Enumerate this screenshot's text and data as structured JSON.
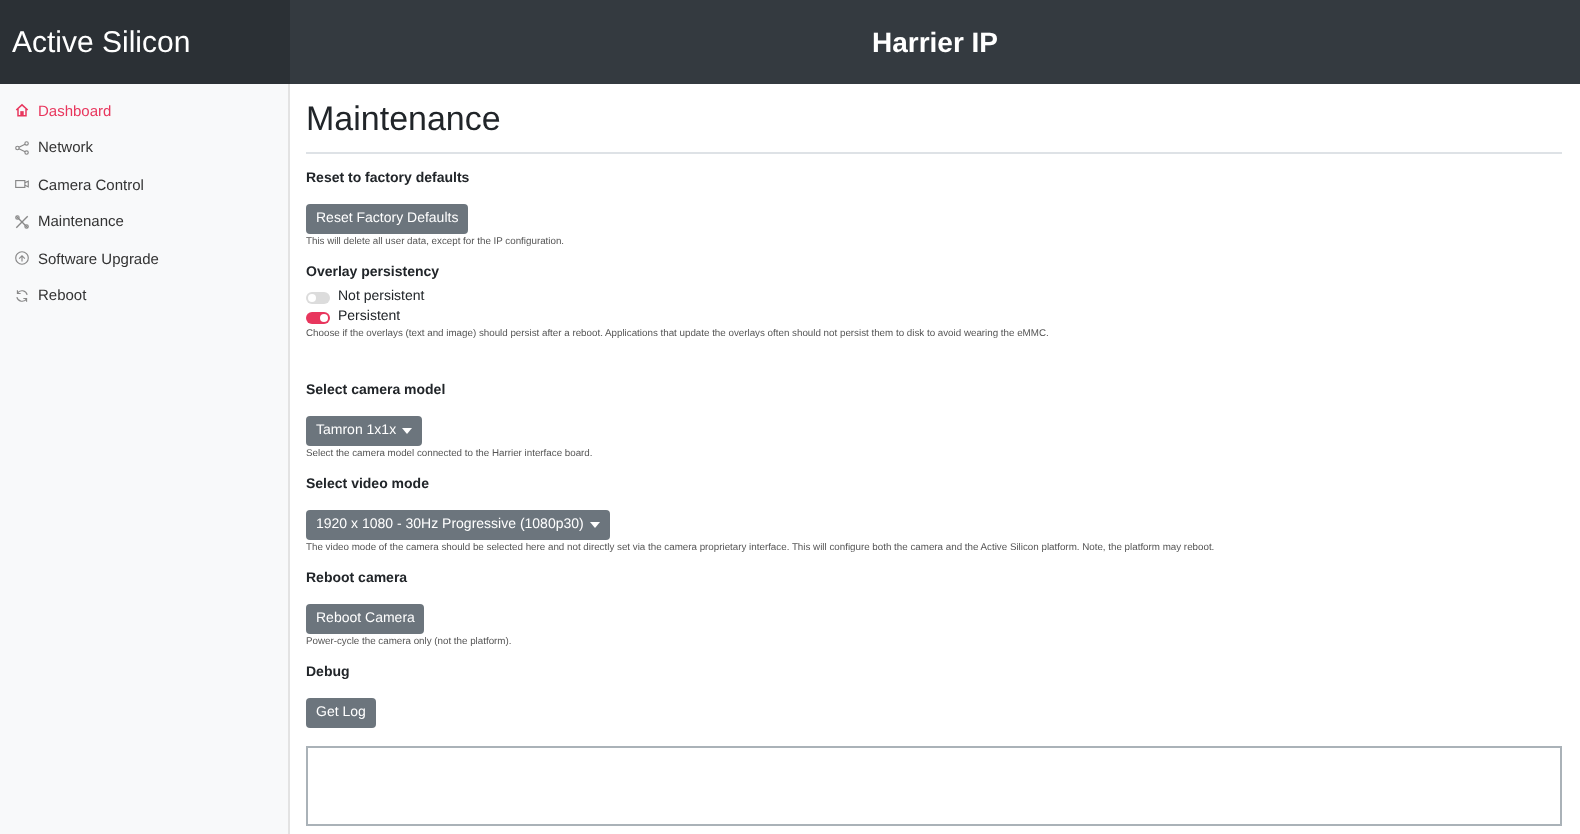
{
  "brand": "Active Silicon",
  "header": {
    "title": "Harrier IP"
  },
  "sidebar": {
    "items": [
      {
        "label": "Dashboard",
        "selected": true
      },
      {
        "label": "Network",
        "selected": false
      },
      {
        "label": "Camera Control",
        "selected": false
      },
      {
        "label": "Maintenance",
        "selected": false
      },
      {
        "label": "Software Upgrade",
        "selected": false
      },
      {
        "label": "Reboot",
        "selected": false
      }
    ]
  },
  "page": {
    "title": "Maintenance",
    "sections": [
      {
        "kind": "button",
        "heading": "Reset to factory defaults",
        "button": "Reset Factory Defaults",
        "help": "This will delete all user data, except for the IP configuration."
      },
      {
        "kind": "toggles",
        "heading": "Overlay persistency",
        "options": [
          {
            "label": "Not persistent",
            "on": false
          },
          {
            "label": "Persistent",
            "on": true
          }
        ],
        "help": "Choose if the overlays (text and image) should persist after a reboot. Applications that update the overlays often should not persist them to disk to avoid wearing the eMMC."
      },
      {
        "kind": "dropdown",
        "heading": "Select camera model",
        "value": "Tamron 1x1x",
        "help": "Select the camera model connected to the Harrier interface board."
      },
      {
        "kind": "dropdown",
        "heading": "Select video mode",
        "value": "1920 x 1080 - 30Hz Progressive (1080p30)",
        "help": "The video mode of the camera should be selected here and not directly set via the camera proprietary interface. This will configure both the camera and the Active Silicon platform. Note, the platform may reboot."
      },
      {
        "kind": "button",
        "heading": "Reboot camera",
        "button": "Reboot Camera",
        "help": "Power-cycle the camera only (not the platform)."
      },
      {
        "kind": "log",
        "heading": "Debug",
        "button": "Get Log"
      }
    ]
  }
}
